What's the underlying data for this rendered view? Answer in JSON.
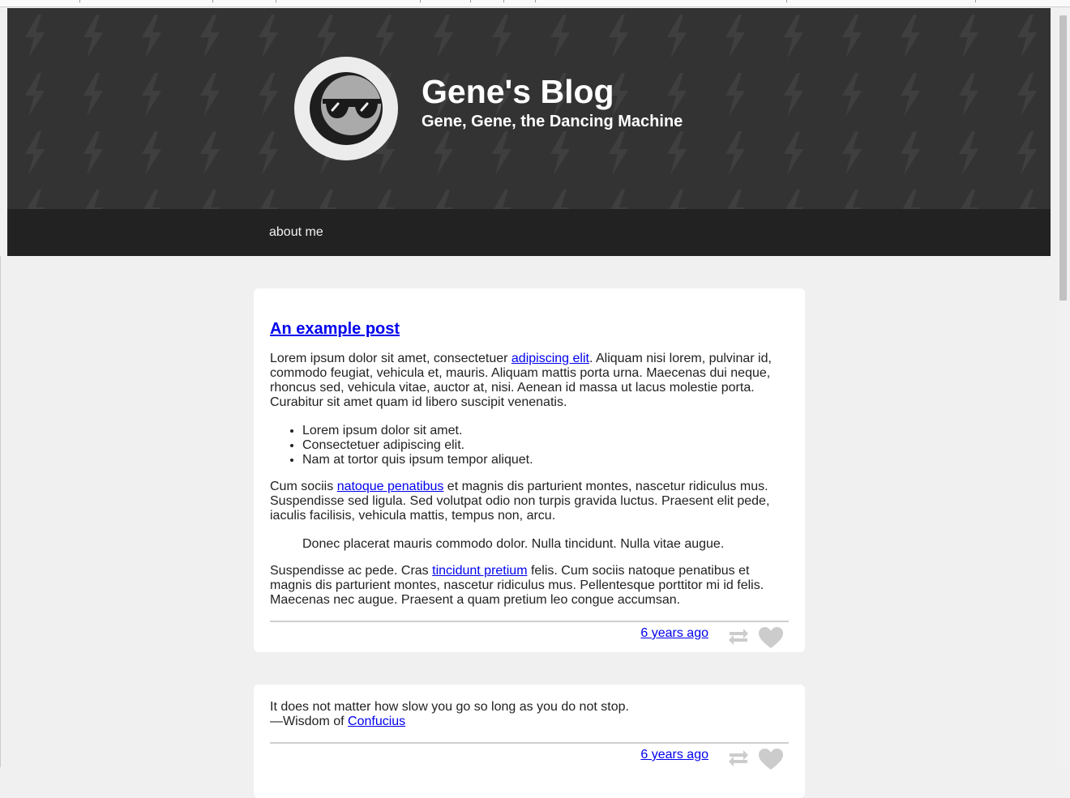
{
  "blog": {
    "title": "Gene's Blog",
    "subtitle": "Gene, Gene, the Dancing Machine"
  },
  "nav": {
    "items": [
      {
        "label": "about me"
      }
    ]
  },
  "posts": [
    {
      "title": "An example post",
      "p1": {
        "before": "Lorem ipsum dolor sit amet, consectetuer ",
        "link": "adipiscing elit",
        "after": ". Aliquam nisi lorem, pulvinar id, commodo feugiat, vehicula et, mauris. Aliquam mattis porta urna. Maecenas dui neque, rhoncus sed, vehicula vitae, auctor at, nisi. Aenean id massa ut lacus molestie porta. Curabitur sit amet quam id libero suscipit venenatis."
      },
      "list": [
        "Lorem ipsum dolor sit amet.",
        "Consectetuer adipiscing elit.",
        "Nam at tortor quis ipsum tempor aliquet."
      ],
      "p2": {
        "before": "Cum sociis ",
        "link": "natoque penatibus",
        "after": " et magnis dis parturient montes, nascetur ridiculus mus. Suspendisse sed ligula. Sed volutpat odio non turpis gravida luctus. Praesent elit pede, iaculis facilisis, vehicula mattis, tempus non, arcu."
      },
      "quote": "Donec placerat mauris commodo dolor. Nulla tincidunt. Nulla vitae augue.",
      "p3": {
        "before": "Suspendisse ac pede. Cras ",
        "link": "tincidunt pretium",
        "after": " felis. Cum sociis natoque penatibus et magnis dis parturient montes, nascetur ridiculus mus. Pellentesque porttitor mi id felis. Maecenas nec augue. Praesent a quam pretium leo congue accumsan."
      },
      "timestamp": "6 years ago"
    },
    {
      "quote": "It does not matter how slow you go so long as you do not stop.",
      "attribution_prefix": "—Wisdom of ",
      "attribution_link": "Confucius",
      "timestamp": "6 years ago"
    }
  ],
  "icons": {
    "avatar": "sunglasses-avatar-icon",
    "reblog": "reblog-icon",
    "like": "heart-icon",
    "header_pattern": "lightning-bolt-icon"
  },
  "colors": {
    "header_bg": "#333333",
    "nav_bg": "#222222",
    "page_bg": "#f0f0f0",
    "link": "#0000ee",
    "icon_gray": "#cccccc"
  }
}
